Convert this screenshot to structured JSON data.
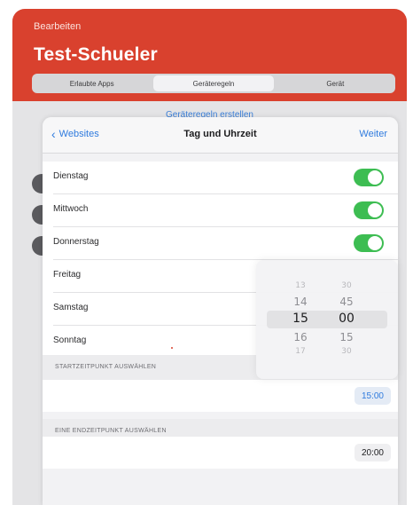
{
  "app": {
    "back_label": "Bearbeiten",
    "title": "Test-Schueler",
    "accent_color": "#d9412e"
  },
  "tabs": [
    {
      "label": "Erlaubte Apps",
      "active": false
    },
    {
      "label": "Geräteregeln",
      "active": true
    },
    {
      "label": "Gerät",
      "active": false
    }
  ],
  "background_link": "Geräteregeln erstellen",
  "modal": {
    "back_label": "Websites",
    "title": "Tag und Uhrzeit",
    "next_label": "Weiter",
    "link_color": "#2f7bde"
  },
  "days": [
    {
      "label": "Dienstag",
      "enabled": true
    },
    {
      "label": "Mittwoch",
      "enabled": true
    },
    {
      "label": "Donnerstag",
      "enabled": true
    },
    {
      "label": "Freitag",
      "enabled": false
    },
    {
      "label": "Samstag",
      "enabled": false
    },
    {
      "label": "Sonntag",
      "enabled": false
    }
  ],
  "start_section": {
    "header": "STARTZEITPUNKT AUSWÄHLEN",
    "value": "15:00"
  },
  "end_section": {
    "header": "EINE ENDZEITPUNKT AUSWÄHLEN",
    "value": "20:00"
  },
  "picker": {
    "hours": [
      "13",
      "14",
      "15",
      "16",
      "17",
      ""
    ],
    "minutes": [
      "30",
      "45",
      "00",
      "15",
      "30",
      ""
    ],
    "selected_hour": "15",
    "selected_minute": "00"
  },
  "toggle_color": "#3dbd52"
}
